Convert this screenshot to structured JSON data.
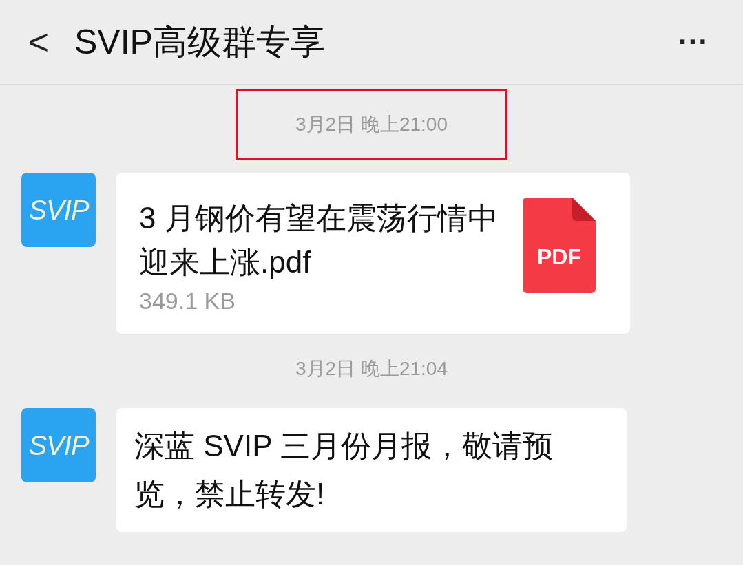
{
  "header": {
    "back": "<",
    "title": "SVIP高级群专享",
    "more": "···"
  },
  "messages": [
    {
      "kind": "time",
      "text": "3月2日 晚上21:00",
      "highlighted": true
    },
    {
      "kind": "file",
      "avatar": "SVIP",
      "file_name": "3 月钢价有望在震荡行情中迎来上涨.pdf",
      "size": "349.1 KB",
      "file_type": "PDF"
    },
    {
      "kind": "time",
      "text": "3月2日 晚上21:04",
      "highlighted": false
    },
    {
      "kind": "text",
      "avatar": "SVIP",
      "text": "深蓝 SVIP 三月份月报，敬请预览，禁止转发!"
    }
  ]
}
